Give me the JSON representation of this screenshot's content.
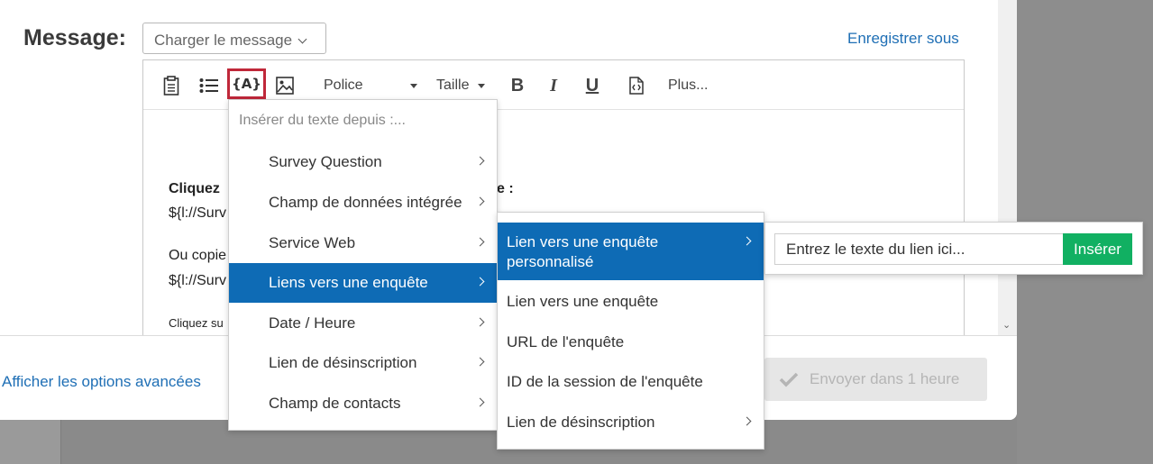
{
  "header": {
    "message_label": "Message:",
    "load_message": "Charger le message",
    "save_as": "Enregistrer sous"
  },
  "toolbar": {
    "font": "Police",
    "size": "Taille",
    "bold": "B",
    "italic": "I",
    "underline": "U",
    "more": "Plus...",
    "piped_text_icon": "{A}"
  },
  "editor": {
    "lines": [
      "Cliquez",
      "${l://Surv",
      "Ou copie",
      "${l://Surv",
      "Cliquez su"
    ],
    "line1_tail": "e :"
  },
  "footer": {
    "advanced": "Afficher les options avancées",
    "send": "Envoyer dans 1 heure"
  },
  "menu": {
    "header": "Insérer du texte depuis :...",
    "items": [
      "Survey Question",
      "Champ de données intégrée",
      "Service Web",
      "Liens vers une enquête",
      "Date / Heure",
      "Lien de désinscription",
      "Champ de contacts"
    ]
  },
  "submenu": {
    "items": [
      "Lien vers une enquête personnalisé",
      "Lien vers une enquête",
      "URL de l'enquête",
      "ID de la session de l'enquête",
      "Lien de désinscription"
    ]
  },
  "link_panel": {
    "placeholder": "Entrez le texte du lien ici...",
    "insert": "Insérer"
  },
  "colors": {
    "accent": "#0e6bb5",
    "link": "#1f6fb5",
    "success": "#11b062",
    "highlight": "#c0283a"
  }
}
